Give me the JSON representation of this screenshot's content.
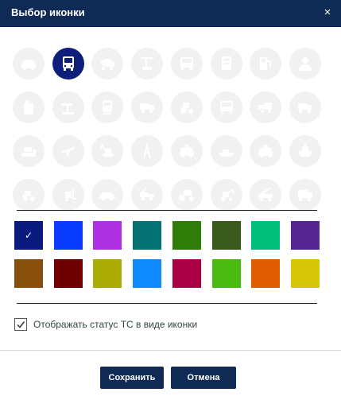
{
  "dialog": {
    "title": "Выбор иконки",
    "close_glyph": "×"
  },
  "icons": [
    {
      "name": "car-icon"
    },
    {
      "name": "bus-icon",
      "selected": true
    },
    {
      "name": "concrete-mixer-icon"
    },
    {
      "name": "crane-icon"
    },
    {
      "name": "truck-front-icon"
    },
    {
      "name": "trailer-icon"
    },
    {
      "name": "fuel-pump-icon"
    },
    {
      "name": "person-icon"
    },
    {
      "name": "canister-icon"
    },
    {
      "name": "oil-pump-icon"
    },
    {
      "name": "train-icon"
    },
    {
      "name": "tanker-icon"
    },
    {
      "name": "tractor-icon"
    },
    {
      "name": "school-bus-icon"
    },
    {
      "name": "harvester-icon"
    },
    {
      "name": "dump-truck-icon"
    },
    {
      "name": "bulldozer-icon"
    },
    {
      "name": "airplane-icon"
    },
    {
      "name": "excavator-icon"
    },
    {
      "name": "oil-rig-icon"
    },
    {
      "name": "taxi-icon"
    },
    {
      "name": "boat-icon"
    },
    {
      "name": "police-car-icon"
    },
    {
      "name": "ship-icon"
    },
    {
      "name": "loader-icon"
    },
    {
      "name": "forklift-icon"
    },
    {
      "name": "sedan-icon"
    },
    {
      "name": "tow-truck-icon"
    },
    {
      "name": "road-roller-icon"
    },
    {
      "name": "backhoe-icon"
    },
    {
      "name": "crane-truck-icon"
    },
    {
      "name": "garbage-truck-icon"
    }
  ],
  "colors": [
    {
      "hex": "#0a1a7f",
      "selected": true
    },
    {
      "hex": "#0a3cff"
    },
    {
      "hex": "#ad31e0"
    },
    {
      "hex": "#057374"
    },
    {
      "hex": "#2f7d08"
    },
    {
      "hex": "#3a5a1c"
    },
    {
      "hex": "#00bf7a"
    },
    {
      "hex": "#562690"
    },
    {
      "hex": "#87500c"
    },
    {
      "hex": "#700000"
    },
    {
      "hex": "#aaac04"
    },
    {
      "hex": "#0f8bff"
    },
    {
      "hex": "#ac0046"
    },
    {
      "hex": "#4aba10"
    },
    {
      "hex": "#e05c00"
    },
    {
      "hex": "#d6c508"
    }
  ],
  "checkmark": "✓",
  "option": {
    "label": "Отображать статус ТС в виде иконки",
    "checked": true
  },
  "buttons": {
    "save": "Сохранить",
    "cancel": "Отмена"
  }
}
